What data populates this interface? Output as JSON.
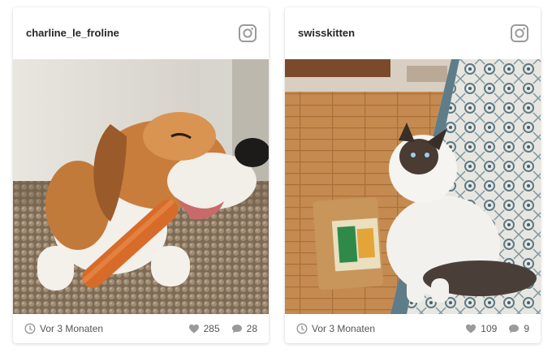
{
  "posts": [
    {
      "username": "charline_le_froline",
      "time": "Vor 3 Monaten",
      "likes": "285",
      "comments": "28",
      "photo": "beagle-chewing-treat"
    },
    {
      "username": "swisskitten",
      "time": "Vor 3 Monaten",
      "likes": "109",
      "comments": "9",
      "photo": "cat-with-treat-bag"
    }
  ],
  "icons": {
    "platform": "instagram-icon",
    "time": "clock-icon",
    "likes": "heart-icon",
    "comments": "comment-bubble-icon"
  },
  "colors": {
    "text": "#262626",
    "muted": "#555555",
    "icon": "#9a9a9a"
  }
}
